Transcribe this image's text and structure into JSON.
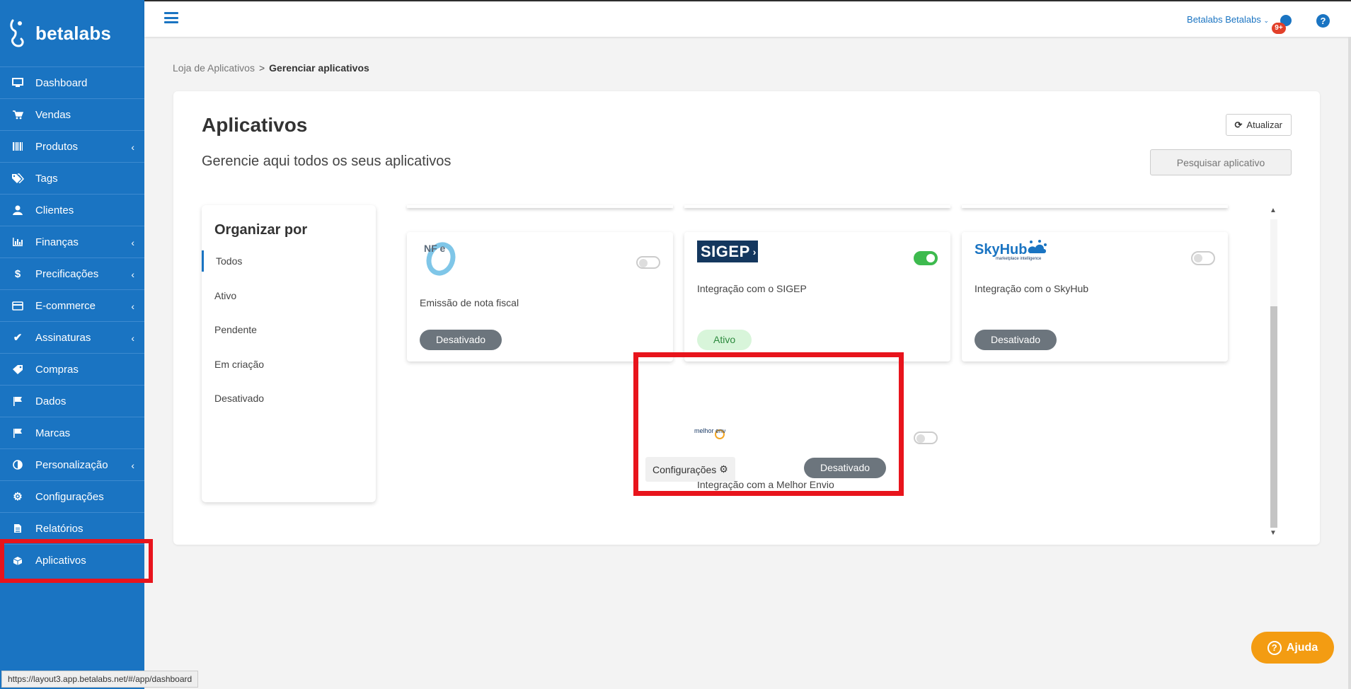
{
  "brand": {
    "name": "betalabs"
  },
  "sidebar": {
    "items": [
      {
        "label": "Dashboard",
        "icon": "monitor-icon"
      },
      {
        "label": "Vendas",
        "icon": "cart-icon"
      },
      {
        "label": "Produtos",
        "icon": "barcode-icon",
        "submenu": true
      },
      {
        "label": "Tags",
        "icon": "tags-icon"
      },
      {
        "label": "Clientes",
        "icon": "user-icon"
      },
      {
        "label": "Finanças",
        "icon": "bar-chart-icon",
        "submenu": true
      },
      {
        "label": "Precificações",
        "icon": "dollar-icon",
        "submenu": true
      },
      {
        "label": "E-commerce",
        "icon": "credit-card-icon",
        "submenu": true
      },
      {
        "label": "Assinaturas",
        "icon": "check-icon",
        "submenu": true
      },
      {
        "label": "Compras",
        "icon": "tag-icon"
      },
      {
        "label": "Dados",
        "icon": "flag-icon"
      },
      {
        "label": "Marcas",
        "icon": "flag-icon"
      },
      {
        "label": "Personalização",
        "icon": "contrast-icon",
        "submenu": true
      },
      {
        "label": "Configurações",
        "icon": "gear-icon"
      },
      {
        "label": "Relatórios",
        "icon": "file-icon"
      },
      {
        "label": "Aplicativos",
        "icon": "cube-icon",
        "active": true
      }
    ]
  },
  "status_url": "https://layout3.app.betalabs.net/#/app/dashboard",
  "topbar": {
    "user_name": "Betalabs Betalabs",
    "notif_badge": "9+"
  },
  "breadcrumb": {
    "parent": "Loja de Aplicativos",
    "separator": ">",
    "current": "Gerenciar aplicativos"
  },
  "page": {
    "title": "Aplicativos",
    "subtitle": "Gerencie aqui todos os seus aplicativos",
    "refresh_label": "Atualizar",
    "search_placeholder": "Pesquisar aplicativo"
  },
  "filter": {
    "title": "Organizar por",
    "options": [
      "Todos",
      "Ativo",
      "Pendente",
      "Em criação",
      "Desativado"
    ],
    "selected": "Todos"
  },
  "apps": [
    {
      "logo": "nfe-logo",
      "logo_text": "NF e",
      "description": "Emissão de nota fiscal",
      "status": "Desativado",
      "enabled": false
    },
    {
      "logo": "sigep-logo",
      "logo_text": "SIGEP",
      "description": "Integração com o SIGEP",
      "status": "Ativo",
      "enabled": true
    },
    {
      "logo": "skyhub-logo",
      "logo_text": "SkyHub",
      "logo_subtext": "marketplace intelligence",
      "description": "Integração com o SkyHub",
      "status": "Desativado",
      "enabled": false
    },
    {
      "logo": "melhor-envio-logo",
      "logo_text": "melhor envio",
      "description": "Integração com a Melhor Envio",
      "status": "Desativado",
      "enabled": false,
      "config_label": "Configurações"
    }
  ],
  "help_button": {
    "label": "Ajuda"
  },
  "colors": {
    "sidebar": "#1a74c2",
    "highlight": "#e8141c",
    "toggle_on": "#3dba4e",
    "status_inactive": "#6c757d",
    "status_active_bg": "#d8f5da",
    "help": "#f39c12"
  }
}
